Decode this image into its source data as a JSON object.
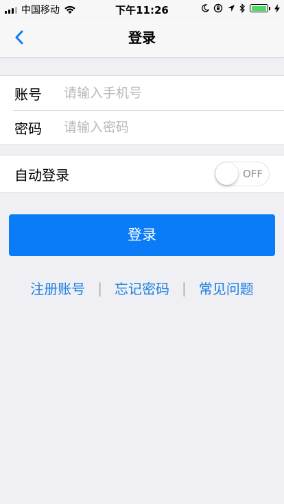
{
  "status_bar": {
    "carrier": "中国移动",
    "time": "下午11:26"
  },
  "nav": {
    "title": "登录"
  },
  "form": {
    "account_label": "账号",
    "account_placeholder": "请输入手机号",
    "password_label": "密码",
    "password_placeholder": "请输入密码"
  },
  "auto_login": {
    "label": "自动登录",
    "toggle_text": "OFF"
  },
  "login_button": {
    "label": "登录"
  },
  "links": {
    "register": "注册账号",
    "separator": "|",
    "forgot": "忘记密码",
    "faq": "常见问题"
  },
  "colors": {
    "accent": "#0a7cf7",
    "link": "#1a7fe0",
    "background": "#efeff4",
    "battery": "#4cd964"
  }
}
